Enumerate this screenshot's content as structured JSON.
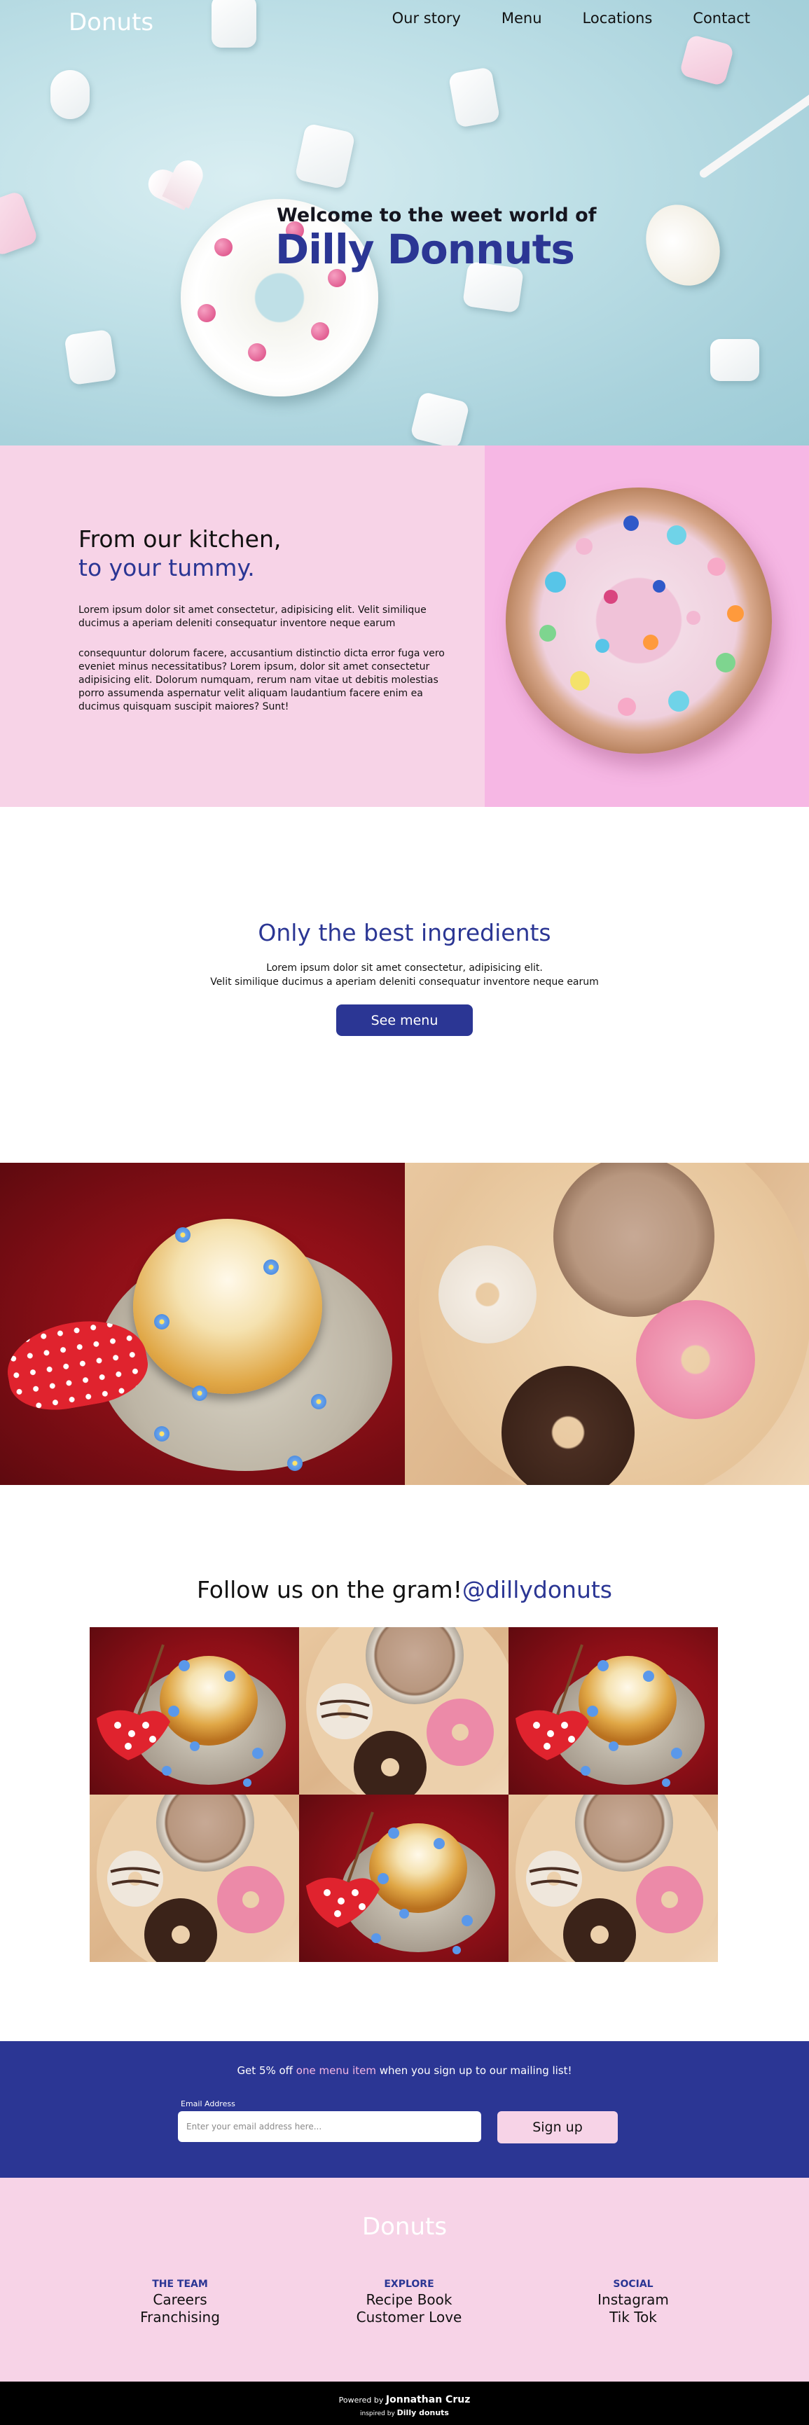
{
  "nav": {
    "logo": "Donuts",
    "links": [
      "Our story",
      "Menu",
      "Locations",
      "Contact"
    ]
  },
  "hero": {
    "subtitle": "Welcome to the weet world of",
    "title": "Dilly Donnuts"
  },
  "kitchen": {
    "heading_line1": "From our kitchen,",
    "heading_line2": "to your tummy.",
    "paragraph1": "Lorem ipsum dolor sit amet consectetur, adipisicing elit. Velit similique ducimus a aperiam deleniti consequatur inventore neque earum",
    "paragraph2": "consequuntur dolorum facere, accusantium distinctio dicta error fuga vero eveniet minus necessitatibus? Lorem ipsum, dolor sit amet consectetur adipisicing elit. Dolorum numquam, rerum nam vitae ut debitis molestias porro assumenda aspernatur velit aliquam laudantium facere enim ea ducimus quisquam suscipit maiores? Sunt!"
  },
  "ingredients": {
    "title": "Only the best ingredients",
    "line1": "Lorem ipsum dolor sit amet consectetur, adipisicing elit.",
    "line2": "Velit similique ducimus a aperiam deleniti consequatur inventore neque earum",
    "button": "See menu"
  },
  "follow": {
    "title": "Follow us on the gram!",
    "handle": "@dillydonuts"
  },
  "newsletter": {
    "promo_before": "Get 5% off ",
    "promo_highlight": "one menu item",
    "promo_after": " when you sign up to our mailing list!",
    "email_label": "Email Address",
    "email_placeholder": "Enter your email address here...",
    "email_value": "",
    "button": "Sign up"
  },
  "footer": {
    "logo": "Donuts",
    "columns": [
      {
        "heading": "THE TEAM",
        "links": [
          "Careers",
          "Franchising"
        ]
      },
      {
        "heading": "EXPLORE",
        "links": [
          "Recipe Book",
          "Customer Love"
        ]
      },
      {
        "heading": "SOCIAL",
        "links": [
          "Instagram",
          "Tik Tok"
        ]
      }
    ],
    "powered_prefix": "Powered by ",
    "powered_name": "Jonnathan Cruz",
    "inspired_prefix": "inspired by ",
    "inspired_name": "Dilly donuts"
  },
  "colors": {
    "brand_blue": "#2b3694",
    "soft_pink": "#f7d3e7",
    "hot_pink": "#f6b7e4",
    "hero_blue": "#bfe0e7",
    "footer_black": "#000000"
  },
  "icons": {
    "gallery_tiles": [
      "red-cake-photo",
      "coffee-donuts-photo",
      "red-cake-photo",
      "coffee-donuts-photo",
      "red-cake-photo",
      "coffee-donuts-photo"
    ]
  }
}
